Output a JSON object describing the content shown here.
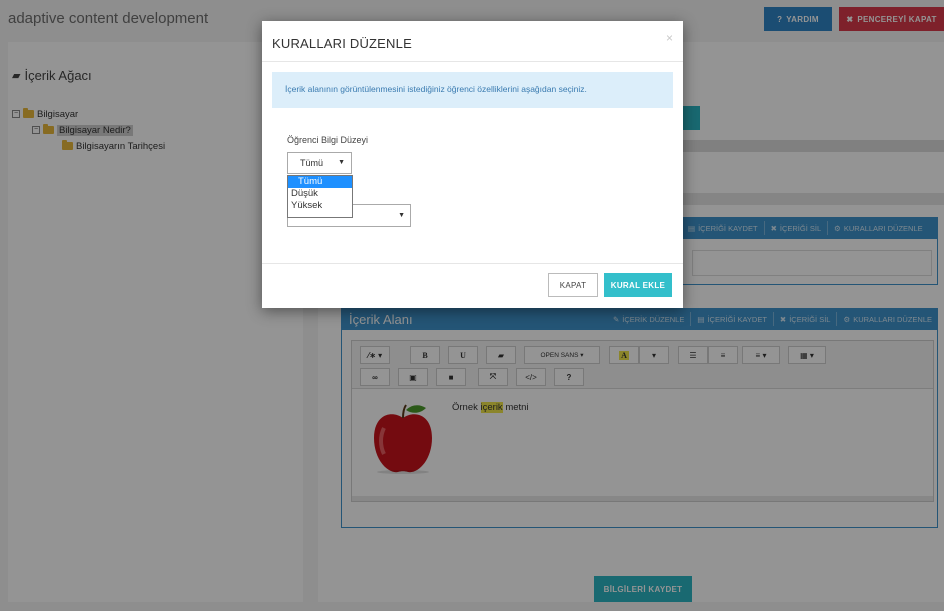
{
  "app": {
    "title": "adaptive content development"
  },
  "header": {
    "help_label": "YARDIM",
    "help_icon": "question-icon",
    "close_window_label": "PENCEREYİ KAPAT",
    "close_window_icon": "close-icon"
  },
  "tree": {
    "title": "İçerik Ağacı",
    "items": [
      {
        "label": "Bilgisayar",
        "expander": "⊟"
      },
      {
        "label": "Bilgisayar Nedir?",
        "expander": "⊟"
      },
      {
        "label": "Bilgisayarın Tarihçesi"
      }
    ]
  },
  "content_panel_top": {
    "actions": [
      {
        "label": "İÇERİĞİ KAYDET"
      },
      {
        "label": "İÇERİĞİ SİL"
      },
      {
        "label": "KURALLARI DÜZENLE"
      }
    ]
  },
  "content_panel": {
    "title": "İçerik Alanı",
    "actions": [
      {
        "label": "İÇERİK DÜZENLE"
      },
      {
        "label": "İÇERİĞİ KAYDET"
      },
      {
        "label": "İÇERİĞİ SİL"
      },
      {
        "label": "KURALLARI DÜZENLE"
      }
    ],
    "toolbar": {
      "font_label": "OPEN SANS ▾",
      "bold": "B",
      "underline": "U",
      "font_color": "A",
      "help": "?"
    },
    "sample_text_before": "Örnek ",
    "sample_text_highlight": "içerik",
    "sample_text_after": " metni"
  },
  "save_info_label": "BİLGİLERİ KAYDET",
  "modal": {
    "title": "KURALLARI DÜZENLE",
    "info_text": "İçerik alanının görüntülenmesini istediğiniz öğrenci özelliklerini aşağıdan seçiniz.",
    "field_label": "Öğrenci Bilgi Düzeyi",
    "selected_value": "Tümü",
    "options": [
      "Tümü",
      "Düşük",
      "Yüksek"
    ],
    "cancel_label": "KAPAT",
    "add_rule_label": "KURAL EKLE"
  },
  "colors": {
    "primary": "#3e93cc",
    "teal": "#33bfcb",
    "danger": "#d9394a",
    "help": "#2f86c7",
    "info_bg": "#dceefa"
  }
}
